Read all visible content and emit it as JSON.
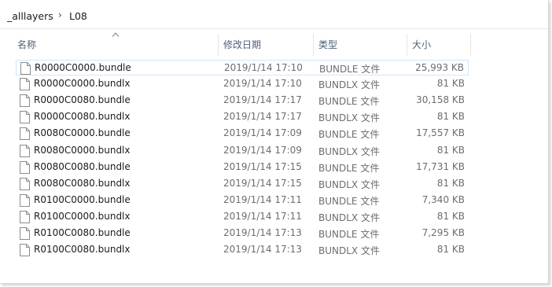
{
  "breadcrumb": {
    "items": [
      "_alllayers",
      "L08"
    ],
    "separator": "›"
  },
  "columns": {
    "name": "名称",
    "date": "修改日期",
    "type": "类型",
    "size": "大小"
  },
  "files": [
    {
      "name": "R0000C0000.bundle",
      "date": "2019/1/14 17:10",
      "type": "BUNDLE 文件",
      "size": "25,993 KB"
    },
    {
      "name": "R0000C0000.bundlx",
      "date": "2019/1/14 17:10",
      "type": "BUNDLX 文件",
      "size": "81 KB"
    },
    {
      "name": "R0000C0080.bundle",
      "date": "2019/1/14 17:17",
      "type": "BUNDLE 文件",
      "size": "30,158 KB"
    },
    {
      "name": "R0000C0080.bundlx",
      "date": "2019/1/14 17:17",
      "type": "BUNDLX 文件",
      "size": "81 KB"
    },
    {
      "name": "R0080C0000.bundle",
      "date": "2019/1/14 17:09",
      "type": "BUNDLE 文件",
      "size": "17,557 KB"
    },
    {
      "name": "R0080C0000.bundlx",
      "date": "2019/1/14 17:09",
      "type": "BUNDLX 文件",
      "size": "81 KB"
    },
    {
      "name": "R0080C0080.bundle",
      "date": "2019/1/14 17:15",
      "type": "BUNDLE 文件",
      "size": "17,731 KB"
    },
    {
      "name": "R0080C0080.bundlx",
      "date": "2019/1/14 17:15",
      "type": "BUNDLX 文件",
      "size": "81 KB"
    },
    {
      "name": "R0100C0000.bundle",
      "date": "2019/1/14 17:11",
      "type": "BUNDLE 文件",
      "size": "7,340 KB"
    },
    {
      "name": "R0100C0000.bundlx",
      "date": "2019/1/14 17:11",
      "type": "BUNDLX 文件",
      "size": "81 KB"
    },
    {
      "name": "R0100C0080.bundle",
      "date": "2019/1/14 17:13",
      "type": "BUNDLE 文件",
      "size": "7,295 KB"
    },
    {
      "name": "R0100C0080.bundlx",
      "date": "2019/1/14 17:13",
      "type": "BUNDLX 文件",
      "size": "81 KB"
    }
  ],
  "icons": {
    "file": "file-icon",
    "sort": "sort-ascending-icon",
    "separator": "chevron-right-icon"
  },
  "colors": {
    "header_text": "#4c607a",
    "selection_border": "#cde8ff",
    "secondary_text": "#6d6d6d"
  }
}
